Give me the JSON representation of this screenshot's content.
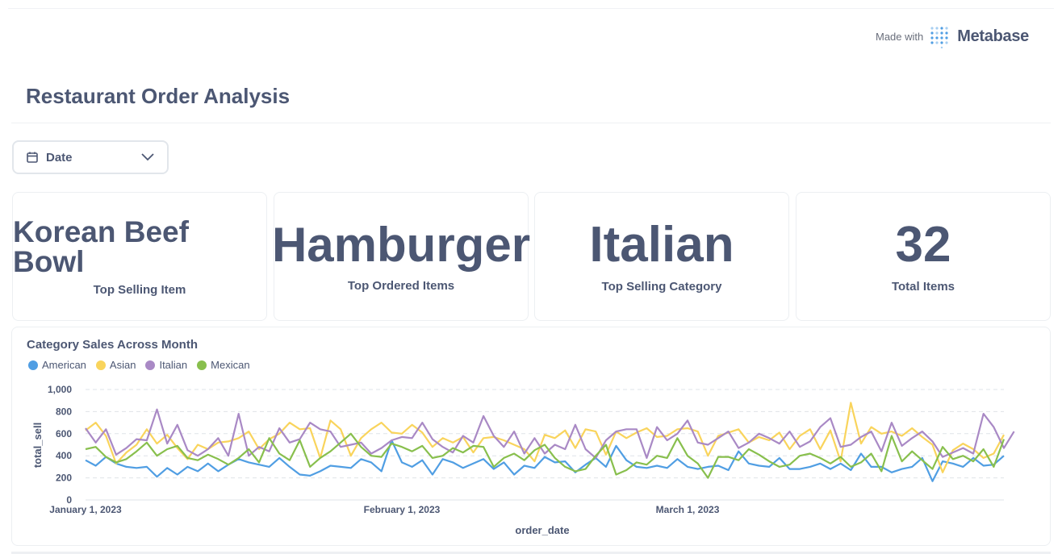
{
  "branding": {
    "made_with": "Made with",
    "brand": "Metabase",
    "brand_color": "#509ee3"
  },
  "dashboard": {
    "title": "Restaurant Order Analysis"
  },
  "filter": {
    "label": "Date",
    "icon": "calendar-icon"
  },
  "cards": [
    {
      "value": "Korean Beef Bowl",
      "label": "Top Selling Item"
    },
    {
      "value": "Hamburger",
      "label": "Top Ordered Items"
    },
    {
      "value": "Italian",
      "label": "Top Selling Category"
    },
    {
      "value": "32",
      "label": "Total Items"
    }
  ],
  "chart_data": {
    "type": "line",
    "title": "Category Sales Across Month",
    "xlabel": "order_date",
    "ylabel": "total_sell",
    "ylim": [
      0,
      1000
    ],
    "yticks": [
      "0",
      "200",
      "400",
      "600",
      "800",
      "1,000"
    ],
    "xtick_labels": [
      "January 1, 2023",
      "February 1, 2023",
      "March 1, 2023"
    ],
    "xtick_days": [
      0,
      31,
      59
    ],
    "days": 91,
    "grid": true,
    "legend_position": "top-left",
    "series": [
      {
        "name": "American",
        "color": "#509ee3",
        "values": [
          360,
          310,
          390,
          330,
          300,
          290,
          300,
          210,
          290,
          230,
          300,
          260,
          330,
          260,
          320,
          370,
          340,
          320,
          300,
          380,
          300,
          230,
          220,
          260,
          310,
          300,
          290,
          370,
          340,
          260,
          540,
          340,
          300,
          360,
          230,
          370,
          340,
          290,
          330,
          370,
          280,
          340,
          230,
          310,
          290,
          390,
          340,
          350,
          250,
          320,
          380,
          300,
          490,
          360,
          300,
          290,
          310,
          290,
          370,
          300,
          280,
          300,
          310,
          270,
          440,
          330,
          310,
          300,
          380,
          280,
          280,
          300,
          330,
          280,
          330,
          270,
          420,
          300,
          300,
          250,
          280,
          300,
          380,
          170,
          350,
          330,
          300,
          380,
          310,
          320,
          400
        ]
      },
      {
        "name": "Asian",
        "color": "#f9d45c",
        "values": [
          630,
          700,
          580,
          330,
          430,
          500,
          640,
          510,
          590,
          470,
          370,
          500,
          460,
          520,
          530,
          560,
          620,
          460,
          550,
          600,
          700,
          640,
          650,
          380,
          720,
          640,
          400,
          560,
          640,
          700,
          610,
          600,
          680,
          610,
          480,
          560,
          520,
          570,
          430,
          560,
          570,
          540,
          500,
          460,
          350,
          590,
          560,
          630,
          470,
          640,
          620,
          410,
          620,
          560,
          610,
          650,
          570,
          580,
          640,
          650,
          620,
          400,
          580,
          610,
          640,
          520,
          570,
          540,
          610,
          460,
          580,
          640,
          460,
          630,
          350,
          880,
          510,
          660,
          600,
          620,
          580,
          650,
          570,
          500,
          250,
          450,
          510,
          460,
          380,
          420,
          590
        ]
      },
      {
        "name": "Italian",
        "color": "#a989c5",
        "values": [
          650,
          520,
          640,
          410,
          470,
          550,
          540,
          820,
          510,
          680,
          450,
          400,
          460,
          560,
          400,
          780,
          400,
          480,
          440,
          650,
          520,
          550,
          700,
          640,
          620,
          480,
          500,
          520,
          420,
          470,
          540,
          570,
          560,
          700,
          550,
          480,
          430,
          580,
          520,
          760,
          580,
          480,
          620,
          420,
          560,
          420,
          500,
          460,
          680,
          460,
          380,
          540,
          620,
          640,
          640,
          380,
          660,
          540,
          600,
          720,
          520,
          500,
          560,
          620,
          470,
          520,
          600,
          560,
          510,
          620,
          480,
          530,
          660,
          740,
          480,
          500,
          570,
          620,
          440,
          700,
          490,
          560,
          620,
          530,
          390,
          430,
          470,
          420,
          780,
          660,
          470,
          620
        ]
      },
      {
        "name": "Mexican",
        "color": "#88bf4d",
        "values": [
          460,
          480,
          390,
          340,
          370,
          440,
          520,
          400,
          460,
          490,
          380,
          360,
          410,
          370,
          320,
          380,
          460,
          340,
          560,
          420,
          360,
          540,
          300,
          380,
          440,
          520,
          600,
          480,
          400,
          390,
          510,
          480,
          440,
          490,
          380,
          400,
          470,
          430,
          490,
          480,
          300,
          380,
          420,
          360,
          450,
          500,
          380,
          300,
          260,
          280,
          400,
          500,
          230,
          270,
          340,
          320,
          400,
          380,
          560,
          400,
          330,
          200,
          390,
          390,
          360,
          460,
          410,
          350,
          300,
          320,
          400,
          420,
          380,
          330,
          390,
          300,
          340,
          420,
          260,
          580,
          350,
          440,
          360,
          280,
          480,
          370,
          400,
          350,
          460,
          300,
          550
        ]
      }
    ]
  }
}
